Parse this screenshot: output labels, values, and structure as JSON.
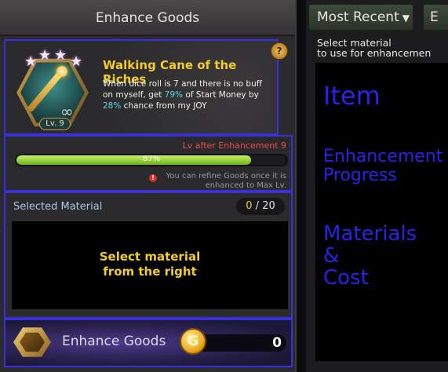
{
  "left_panel": {
    "title": "Enhance Goods",
    "item": {
      "name": "Walking Cane of the Riches",
      "level": "Lv. 9",
      "stars": [
        "★",
        "★",
        "★",
        "★"
      ],
      "desc_1": "When dice roll is 7 and there is no buff on myself, get ",
      "desc_pct1": "79%",
      "desc_2": " of Start Money by ",
      "desc_pct2": "28%",
      "desc_3": " chance from my JOY",
      "info_icon": "?"
    },
    "progress": {
      "lv_after": "Lv after Enhancement 9",
      "percent_label": "87%",
      "percent_value": 0.87,
      "warn_icon": "!",
      "warning": "You can refine Goods once it is enhanced to Max Lv."
    },
    "materials": {
      "label": "Selected Material",
      "count_current": "0",
      "count_sep": " / ",
      "count_max": "20",
      "drop_line1": "Select material",
      "drop_line2": "from the right"
    },
    "enhance": {
      "button_label": "Enhance Goods",
      "coin_symbol": "G",
      "cost": "0"
    }
  },
  "right_panel": {
    "dropdown_label": "Most Recent",
    "dropdown_caret": "▼",
    "second_button_label": "E",
    "instruction_line1": "Select material",
    "instruction_line2": "to use for enhancemen"
  },
  "overlay_labels": {
    "item": "Item",
    "progress_1": "Enhancement",
    "progress_2": "Progress",
    "materials_1": "Materials",
    "materials_2": "&",
    "materials_3": "Cost"
  },
  "colors": {
    "annotation_box": "#3a2fd8",
    "item_name": "#f2cc2a",
    "highlight": "#58d6e6",
    "warning": "#ee4a4a",
    "progress_fill": "#8fd02a"
  }
}
